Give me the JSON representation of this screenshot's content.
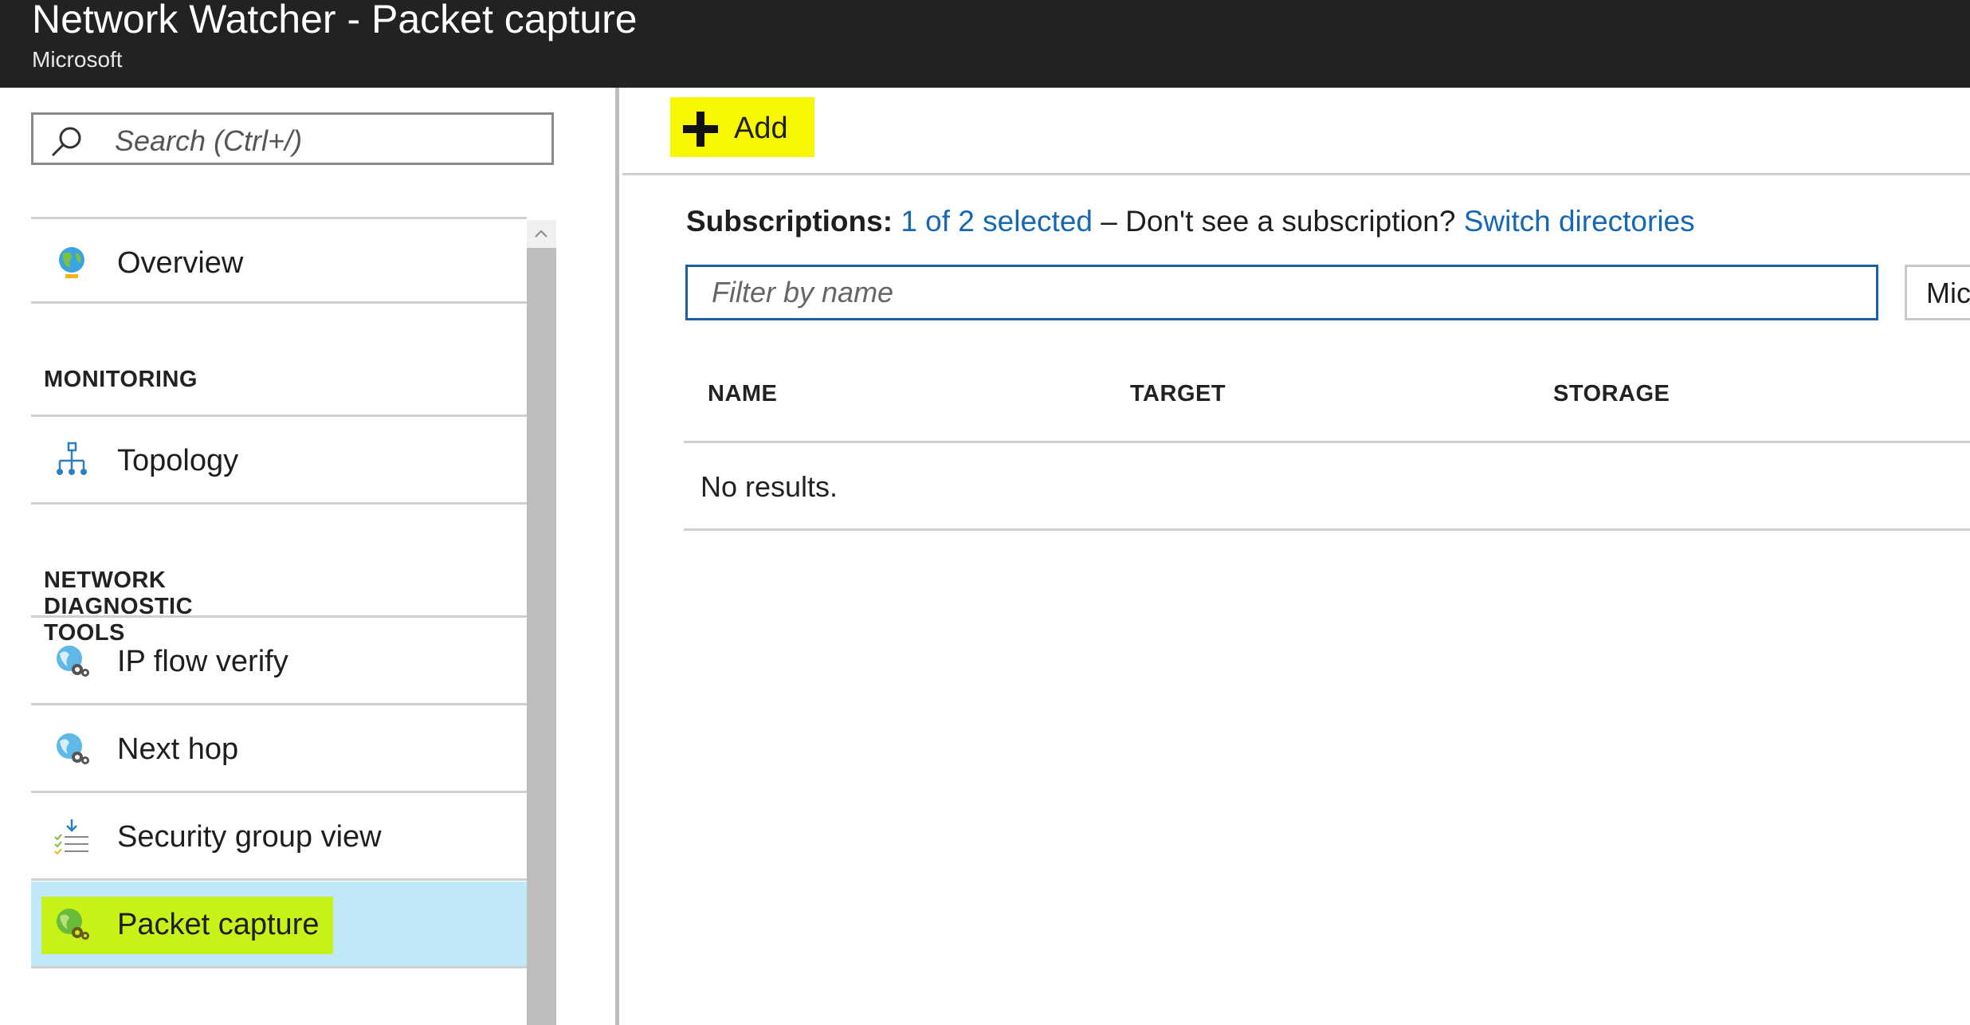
{
  "header": {
    "title": "Network Watcher - Packet capture",
    "subtitle": "Microsoft"
  },
  "sidebar": {
    "search_placeholder": "Search (Ctrl+/)",
    "overview": "Overview",
    "sections": [
      {
        "label": "MONITORING",
        "items": [
          {
            "label": "Topology",
            "icon": "topology-icon"
          }
        ]
      },
      {
        "label": "NETWORK DIAGNOSTIC TOOLS",
        "items": [
          {
            "label": "IP flow verify",
            "icon": "globe-gear-icon"
          },
          {
            "label": "Next hop",
            "icon": "globe-gear-icon"
          },
          {
            "label": "Security group view",
            "icon": "checklist-icon"
          },
          {
            "label": "Packet capture",
            "icon": "globe-gear-icon",
            "selected": true,
            "highlight": "#c6f21a"
          }
        ]
      }
    ]
  },
  "toolbar": {
    "add_label": "Add",
    "add_highlight": "#f7f700"
  },
  "main": {
    "subscriptions_label": "Subscriptions:",
    "subscriptions_value": "1 of 2 selected",
    "subscriptions_text": "– Don't see a subscription?",
    "switch_link": "Switch directories",
    "filter_placeholder": "Filter by name",
    "dropdown_value": "Mic",
    "columns": [
      "NAME",
      "TARGET",
      "STORAGE"
    ],
    "empty_text": "No results."
  },
  "colors": {
    "header_bg": "#222222",
    "link": "#1568b4",
    "selected_bg": "#bfe9f8",
    "filter_border": "#1a5fa8"
  }
}
